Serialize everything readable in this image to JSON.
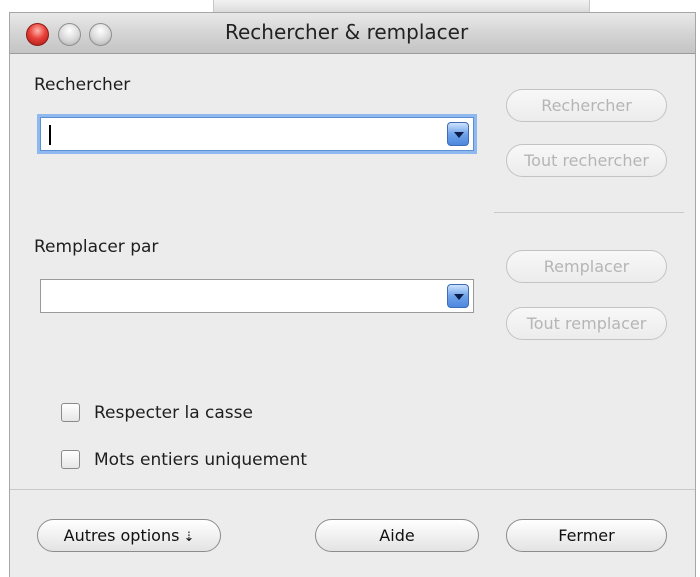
{
  "window": {
    "title": "Rechercher & remplacer"
  },
  "find": {
    "label": "Rechercher",
    "value": "",
    "search_button": "Rechercher",
    "search_all_button": "Tout rechercher"
  },
  "replace": {
    "label": "Remplacer par",
    "value": "",
    "replace_button": "Remplacer",
    "replace_all_button": "Tout remplacer"
  },
  "options": {
    "match_case": "Respecter la casse",
    "whole_words": "Mots entiers uniquement"
  },
  "footer": {
    "more_options": "Autres options",
    "more_options_icon": "⇣",
    "help": "Aide",
    "close": "Fermer"
  },
  "colors": {
    "window_bg": "#ececec",
    "focus_ring": "#8fb8ee",
    "dropdown_arrow": "#4d88df",
    "close_light": "#e8413a"
  }
}
